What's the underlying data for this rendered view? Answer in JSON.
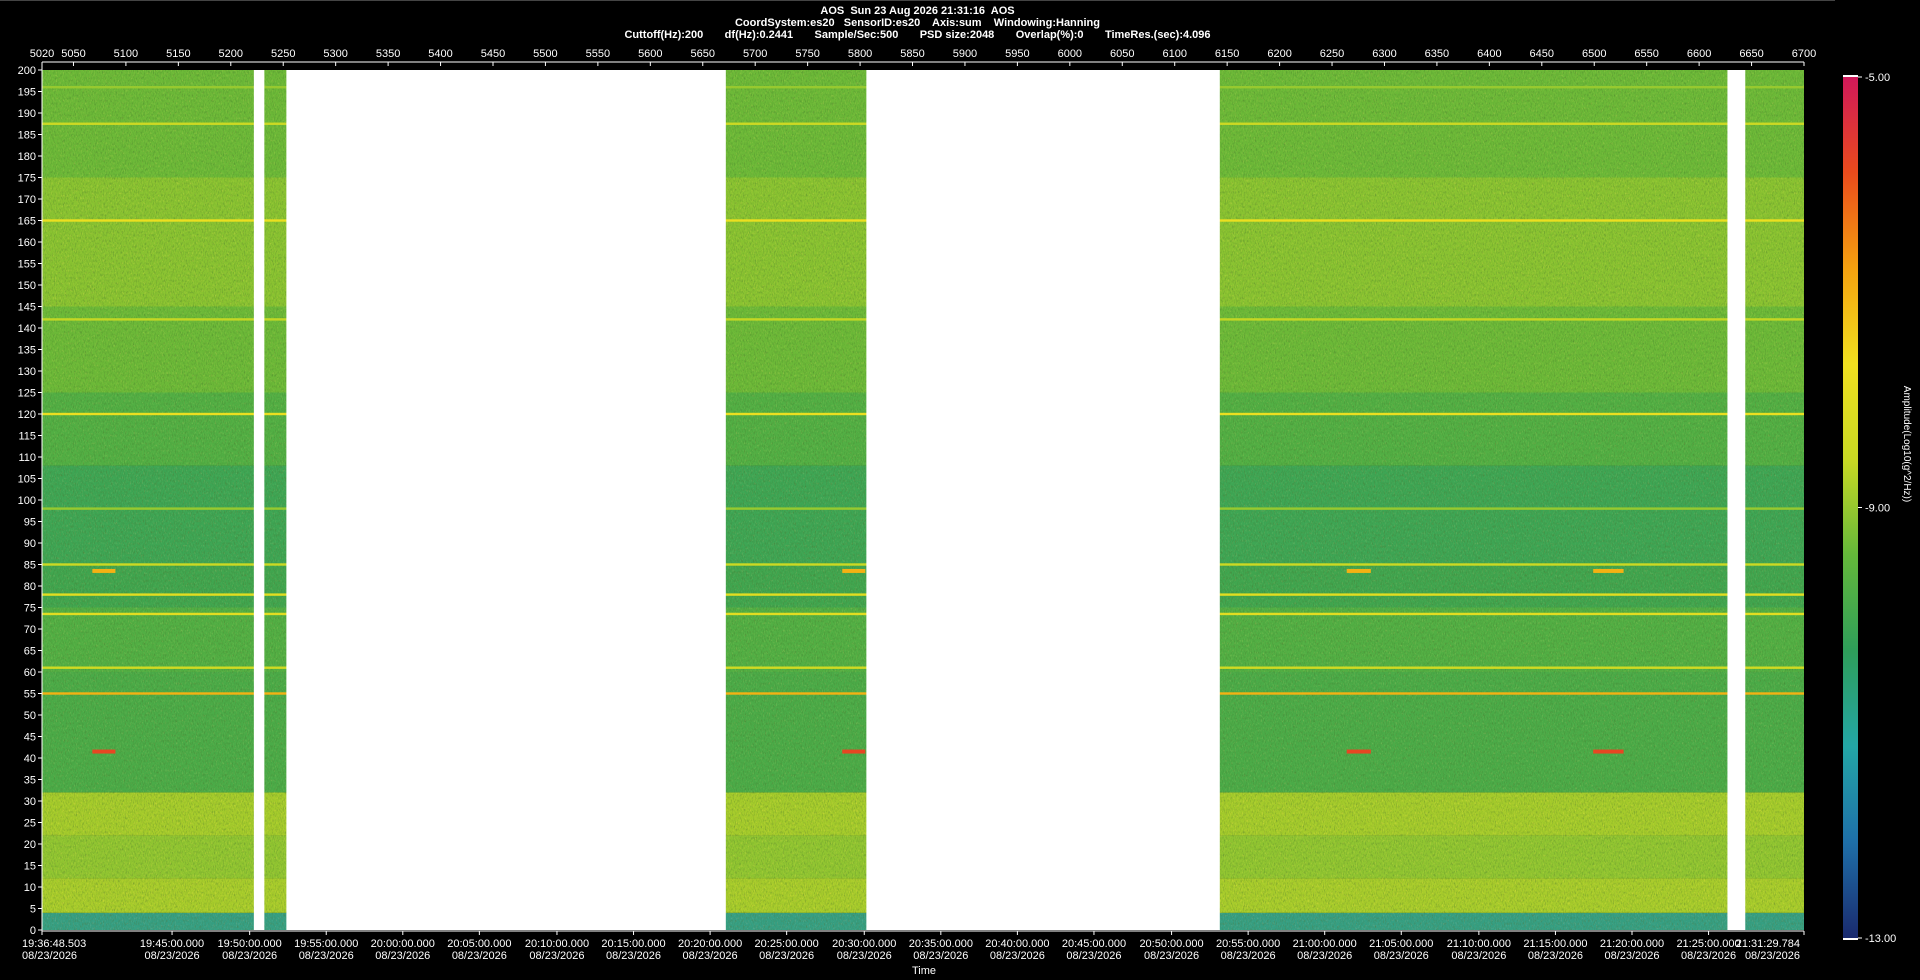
{
  "header": {
    "line1": "AOS  Sun 23 Aug 2026 21:31:16  AOS",
    "line2": "CoordSystem:es20   SensorID:es20    Axis:sum    Windowing:Hanning",
    "line3": "Cuttoff(Hz):200       df(Hz):0.2441       Sample/Sec:500       PSD size:2048       Overlap(%):0       TimeRes.(sec):4.096"
  },
  "colors": {
    "background": "#000000",
    "axis": "#ffffff",
    "gap": "#ffffff"
  },
  "chart_data": {
    "type": "heatmap",
    "title": "",
    "xlabel": "Time",
    "ylabel": "",
    "colorbar_label": "Amplitude(Log10(g^2/Hz))",
    "colorbar_ticks": [
      "-5.00",
      "-9.00",
      "-13.00"
    ],
    "colorbar_range": [
      -13,
      -5
    ],
    "colormap": [
      "#1a2a6e",
      "#1e6fa8",
      "#23a6a6",
      "#2e9e5a",
      "#64b83a",
      "#c9d923",
      "#f1e01f",
      "#f5a10f",
      "#ea4b1c",
      "#d0185a"
    ],
    "ylim": [
      0,
      200
    ],
    "y_ticks": [
      200,
      195,
      190,
      185,
      180,
      175,
      170,
      165,
      160,
      155,
      150,
      145,
      140,
      135,
      130,
      125,
      120,
      115,
      110,
      105,
      100,
      95,
      90,
      85,
      80,
      75,
      70,
      65,
      60,
      55,
      50,
      45,
      40,
      35,
      30,
      25,
      20,
      15,
      10,
      5,
      0
    ],
    "top_axis_range": [
      5020,
      6700
    ],
    "top_ticks": [
      5020,
      5050,
      5100,
      5150,
      5200,
      5250,
      5300,
      5350,
      5400,
      5450,
      5500,
      5550,
      5600,
      5650,
      5700,
      5750,
      5800,
      5850,
      5900,
      5950,
      6000,
      6050,
      6100,
      6150,
      6200,
      6250,
      6300,
      6350,
      6400,
      6450,
      6500,
      6550,
      6600,
      6650,
      6700
    ],
    "gaps": [
      [
        5222,
        5232
      ],
      [
        5253,
        5672
      ],
      [
        5806,
        6143
      ],
      [
        6627,
        6644
      ]
    ],
    "time_ticks": [
      {
        "v": 5020,
        "t": "19:36:48.503",
        "d": "08/23/2026",
        "a": "left"
      },
      {
        "v": 5144,
        "t": "19:45:00.000",
        "d": "08/23/2026",
        "a": "center"
      },
      {
        "v": 5218,
        "t": "19:50:00.000",
        "d": "08/23/2026",
        "a": "center"
      },
      {
        "v": 5291,
        "t": "19:55:00.000",
        "d": "08/23/2026",
        "a": "center"
      },
      {
        "v": 5364,
        "t": "20:00:00.000",
        "d": "08/23/2026",
        "a": "center"
      },
      {
        "v": 5437,
        "t": "20:05:00.000",
        "d": "08/23/2026",
        "a": "center"
      },
      {
        "v": 5511,
        "t": "20:10:00.000",
        "d": "08/23/2026",
        "a": "center"
      },
      {
        "v": 5584,
        "t": "20:15:00.000",
        "d": "08/23/2026",
        "a": "center"
      },
      {
        "v": 5657,
        "t": "20:20:00.000",
        "d": "08/23/2026",
        "a": "center"
      },
      {
        "v": 5730,
        "t": "20:25:00.000",
        "d": "08/23/2026",
        "a": "center"
      },
      {
        "v": 5804,
        "t": "20:30:00.000",
        "d": "08/23/2026",
        "a": "center"
      },
      {
        "v": 5877,
        "t": "20:35:00.000",
        "d": "08/23/2026",
        "a": "center"
      },
      {
        "v": 5950,
        "t": "20:40:00.000",
        "d": "08/23/2026",
        "a": "center"
      },
      {
        "v": 6023,
        "t": "20:45:00.000",
        "d": "08/23/2026",
        "a": "center"
      },
      {
        "v": 6097,
        "t": "20:50:00.000",
        "d": "08/23/2026",
        "a": "center"
      },
      {
        "v": 6170,
        "t": "20:55:00.000",
        "d": "08/23/2026",
        "a": "center"
      },
      {
        "v": 6243,
        "t": "21:00:00.000",
        "d": "08/23/2026",
        "a": "center"
      },
      {
        "v": 6316,
        "t": "21:05:00.000",
        "d": "08/23/2026",
        "a": "center"
      },
      {
        "v": 6390,
        "t": "21:10:00.000",
        "d": "08/23/2026",
        "a": "center"
      },
      {
        "v": 6463,
        "t": "21:15:00.000",
        "d": "08/23/2026",
        "a": "center"
      },
      {
        "v": 6536,
        "t": "21:20:00.000",
        "d": "08/23/2026",
        "a": "center"
      },
      {
        "v": 6609,
        "t": "21:25:00.000",
        "d": "08/23/2026",
        "a": "center"
      },
      {
        "v": 6700,
        "t": "21:31:29.784",
        "d": "08/23/2026",
        "a": "right"
      }
    ],
    "bands": [
      {
        "y0": 0,
        "y1": 4,
        "level": -11.5
      },
      {
        "y0": 4,
        "y1": 12,
        "level": -8.4
      },
      {
        "y0": 12,
        "y1": 22,
        "level": -8.8
      },
      {
        "y0": 22,
        "y1": 32,
        "level": -8.5
      },
      {
        "y0": 32,
        "y1": 60,
        "level": -10.0
      },
      {
        "y0": 60,
        "y1": 75,
        "level": -9.8
      },
      {
        "y0": 75,
        "y1": 85,
        "level": -10.3
      },
      {
        "y0": 85,
        "y1": 108,
        "level": -10.4
      },
      {
        "y0": 108,
        "y1": 125,
        "level": -9.8
      },
      {
        "y0": 125,
        "y1": 145,
        "level": -9.3
      },
      {
        "y0": 145,
        "y1": 175,
        "level": -8.9
      },
      {
        "y0": 175,
        "y1": 200,
        "level": -9.3
      }
    ],
    "lines": [
      {
        "f": 55,
        "level": -7.0
      },
      {
        "f": 73.5,
        "level": -8.0
      },
      {
        "f": 78,
        "level": -8.0
      },
      {
        "f": 85,
        "level": -8.5
      },
      {
        "f": 61,
        "level": -8.4
      },
      {
        "f": 98,
        "level": -9.0
      },
      {
        "f": 120,
        "level": -7.8
      },
      {
        "f": 142,
        "level": -8.6
      },
      {
        "f": 165,
        "level": -7.8
      },
      {
        "f": 187.5,
        "level": -8.5
      },
      {
        "f": 196,
        "level": -9.0
      }
    ],
    "events": [
      {
        "x0": 5068,
        "x1": 5090,
        "f": 41.5,
        "level": -5.8
      },
      {
        "x0": 5068,
        "x1": 5090,
        "f": 83.5,
        "level": -7.0
      },
      {
        "x0": 5783,
        "x1": 5805,
        "f": 41.5,
        "level": -5.8
      },
      {
        "x0": 5783,
        "x1": 5805,
        "f": 83.5,
        "level": -7.0
      },
      {
        "x0": 6264,
        "x1": 6287,
        "f": 41.5,
        "level": -5.8
      },
      {
        "x0": 6264,
        "x1": 6287,
        "f": 83.5,
        "level": -7.0
      },
      {
        "x0": 6499,
        "x1": 6528,
        "f": 41.5,
        "level": -5.8
      },
      {
        "x0": 6499,
        "x1": 6528,
        "f": 83.5,
        "level": -7.0
      }
    ]
  }
}
